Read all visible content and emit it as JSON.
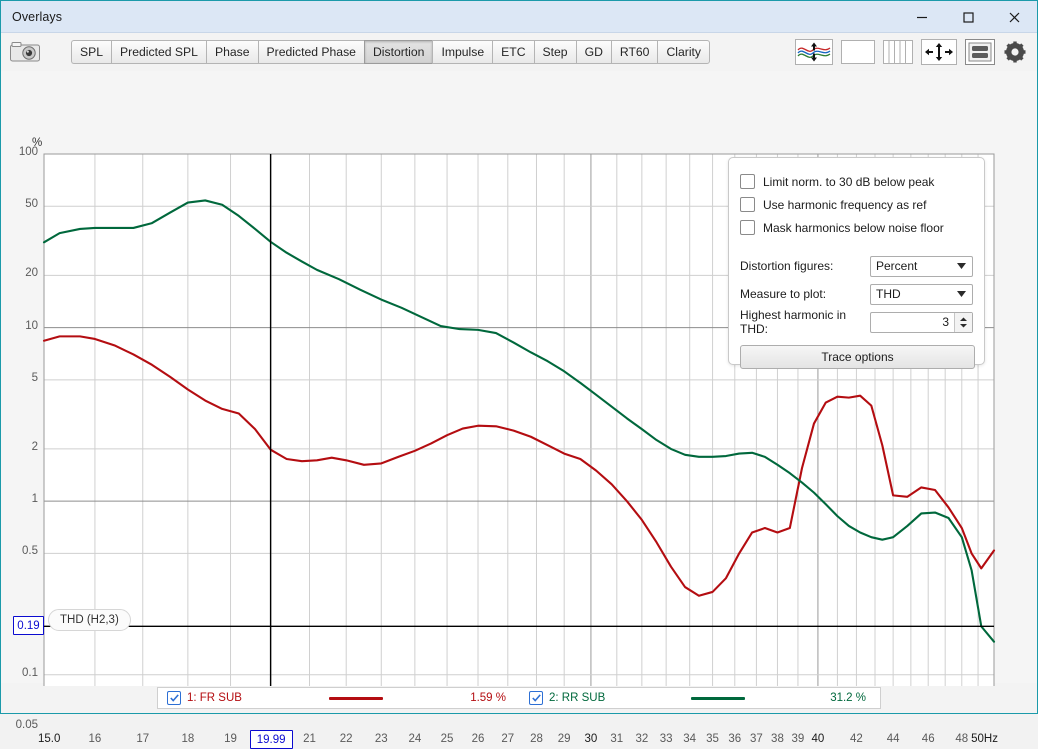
{
  "window": {
    "title": "Overlays",
    "controls": [
      {
        "name": "minimize",
        "glyph": "minimize-icon"
      },
      {
        "name": "maximize",
        "glyph": "maximize-icon"
      },
      {
        "name": "close",
        "glyph": "close-icon"
      }
    ]
  },
  "toolbar": {
    "camera_icon": "camera-icon",
    "tabs": [
      {
        "label": "SPL",
        "active": false
      },
      {
        "label": "Predicted SPL",
        "active": false
      },
      {
        "label": "Phase",
        "active": false
      },
      {
        "label": "Predicted Phase",
        "active": false
      },
      {
        "label": "Distortion",
        "active": true
      },
      {
        "label": "Impulse",
        "active": false
      },
      {
        "label": "ETC",
        "active": false
      },
      {
        "label": "Step",
        "active": false
      },
      {
        "label": "GD",
        "active": false
      },
      {
        "label": "RT60",
        "active": false
      },
      {
        "label": "Clarity",
        "active": false
      }
    ],
    "right_tools": [
      {
        "name": "waveform-offset-icon"
      },
      {
        "name": "blank-panel-icon"
      },
      {
        "name": "vertical-bars-icon"
      },
      {
        "name": "fit-to-window-icon"
      },
      {
        "name": "layout-rows-icon"
      },
      {
        "name": "gear-icon"
      }
    ]
  },
  "settings_panel": {
    "checkboxes": [
      {
        "label": "Limit norm. to 30 dB below peak",
        "checked": false
      },
      {
        "label": "Use harmonic frequency as ref",
        "checked": false
      },
      {
        "label": "Mask harmonics below noise floor",
        "checked": false
      }
    ],
    "fields": [
      {
        "label": "Distortion figures:",
        "value": "Percent",
        "type": "combo"
      },
      {
        "label": "Measure to plot:",
        "value": "THD",
        "type": "combo"
      },
      {
        "label": "Highest harmonic in THD:",
        "value": "3",
        "type": "spinner"
      }
    ],
    "button": "Trace options"
  },
  "chart_data": {
    "type": "line",
    "title": "",
    "badge": "THD (H2,3)",
    "xlabel": "",
    "ylabel": "%",
    "x_unit_suffix": "Hz",
    "xscale": "log",
    "yscale": "log",
    "xlim": [
      15.0,
      50.0
    ],
    "ylim": [
      0.05,
      100
    ],
    "grid": true,
    "legend_position": "bottom",
    "x_ticks": [
      {
        "value": 15.0,
        "label": "15.0",
        "major": true
      },
      {
        "value": 16,
        "label": "16",
        "major": false
      },
      {
        "value": 17,
        "label": "17",
        "major": false
      },
      {
        "value": 18,
        "label": "18",
        "major": false
      },
      {
        "value": 19,
        "label": "19",
        "major": false
      },
      {
        "value": 20,
        "label": "",
        "major": false
      },
      {
        "value": 21,
        "label": "21",
        "major": false
      },
      {
        "value": 22,
        "label": "22",
        "major": false
      },
      {
        "value": 23,
        "label": "23",
        "major": false
      },
      {
        "value": 24,
        "label": "24",
        "major": false
      },
      {
        "value": 25,
        "label": "25",
        "major": false
      },
      {
        "value": 26,
        "label": "26",
        "major": false
      },
      {
        "value": 27,
        "label": "27",
        "major": false
      },
      {
        "value": 28,
        "label": "28",
        "major": false
      },
      {
        "value": 29,
        "label": "29",
        "major": false
      },
      {
        "value": 30,
        "label": "30",
        "major": true
      },
      {
        "value": 31,
        "label": "31",
        "major": false
      },
      {
        "value": 32,
        "label": "32",
        "major": false
      },
      {
        "value": 33,
        "label": "33",
        "major": false
      },
      {
        "value": 34,
        "label": "34",
        "major": false
      },
      {
        "value": 35,
        "label": "35",
        "major": false
      },
      {
        "value": 36,
        "label": "36",
        "major": false
      },
      {
        "value": 37,
        "label": "37",
        "major": false
      },
      {
        "value": 38,
        "label": "38",
        "major": false
      },
      {
        "value": 39,
        "label": "39",
        "major": false
      },
      {
        "value": 40,
        "label": "40",
        "major": true
      },
      {
        "value": 42,
        "label": "42",
        "major": false
      },
      {
        "value": 44,
        "label": "44",
        "major": false
      },
      {
        "value": 46,
        "label": "46",
        "major": false
      },
      {
        "value": 48,
        "label": "48",
        "major": false
      },
      {
        "value": 50,
        "label": "50Hz",
        "major": true
      }
    ],
    "y_ticks": [
      {
        "value": 100,
        "label": "100"
      },
      {
        "value": 50,
        "label": "50"
      },
      {
        "value": 20,
        "label": "20"
      },
      {
        "value": 10,
        "label": "10"
      },
      {
        "value": 5,
        "label": "5"
      },
      {
        "value": 2,
        "label": "2"
      },
      {
        "value": 1,
        "label": "1"
      },
      {
        "value": 0.5,
        "label": "0.5"
      },
      {
        "value": 0.1,
        "label": "0.1"
      },
      {
        "value": 0.05,
        "label": "0.05"
      }
    ],
    "cursor": {
      "x_value": 19.99,
      "x_label": "19.99",
      "y_value": 0.19,
      "y_label": "0.19"
    },
    "series": [
      {
        "name": "1: FR SUB",
        "color": "#b40d11",
        "value_at_cursor": "1.59 %",
        "x": [
          15.0,
          15.3,
          15.7,
          16.0,
          16.4,
          16.8,
          17.2,
          17.6,
          18.0,
          18.4,
          18.8,
          19.2,
          19.6,
          19.99,
          20.4,
          20.8,
          21.2,
          21.6,
          22.0,
          22.5,
          23.0,
          23.5,
          24.0,
          24.5,
          25.0,
          25.5,
          26.0,
          26.6,
          27.2,
          27.8,
          28.4,
          29.0,
          29.6,
          30.2,
          30.8,
          31.4,
          32.0,
          32.6,
          33.2,
          33.8,
          34.4,
          35.0,
          35.6,
          36.2,
          36.8,
          37.4,
          38.0,
          38.6,
          39.2,
          39.8,
          40.4,
          41.0,
          41.6,
          42.2,
          42.8,
          43.4,
          44.0,
          44.8,
          45.6,
          46.4,
          47.2,
          48.0,
          48.6,
          49.2,
          50.0
        ],
        "y": [
          8.4,
          8.9,
          8.9,
          8.6,
          7.9,
          7.0,
          6.1,
          5.2,
          4.4,
          3.8,
          3.4,
          3.2,
          2.6,
          1.98,
          1.75,
          1.7,
          1.72,
          1.78,
          1.72,
          1.62,
          1.65,
          1.8,
          1.95,
          2.15,
          2.4,
          2.62,
          2.72,
          2.7,
          2.55,
          2.35,
          2.1,
          1.88,
          1.75,
          1.5,
          1.25,
          1.0,
          0.78,
          0.58,
          0.42,
          0.32,
          0.285,
          0.3,
          0.36,
          0.5,
          0.66,
          0.7,
          0.66,
          0.7,
          1.55,
          2.8,
          3.7,
          4.0,
          3.95,
          4.05,
          3.55,
          2.1,
          1.08,
          1.06,
          1.2,
          1.16,
          0.92,
          0.7,
          0.5,
          0.41,
          0.52
        ]
      },
      {
        "name": "2: RR SUB",
        "color": "#00683c",
        "value_at_cursor": "31.2 %",
        "x": [
          15.0,
          15.3,
          15.7,
          16.0,
          16.4,
          16.8,
          17.2,
          17.6,
          18.0,
          18.4,
          18.8,
          19.2,
          19.6,
          19.99,
          20.4,
          20.8,
          21.2,
          21.8,
          22.4,
          23.0,
          23.6,
          24.2,
          24.8,
          25.4,
          26.0,
          26.6,
          27.2,
          27.8,
          28.4,
          29.0,
          29.6,
          30.2,
          30.8,
          31.4,
          32.0,
          32.6,
          33.2,
          33.8,
          34.4,
          35.0,
          35.6,
          36.2,
          36.8,
          37.4,
          38.0,
          38.6,
          39.2,
          39.8,
          40.4,
          41.0,
          41.6,
          42.2,
          42.8,
          43.4,
          44.0,
          44.8,
          45.6,
          46.4,
          47.2,
          48.0,
          48.6,
          49.2,
          50.0
        ],
        "y": [
          31.0,
          35.0,
          37.0,
          37.5,
          37.5,
          37.5,
          40.0,
          46.0,
          52.5,
          54.0,
          51.0,
          44.0,
          37.0,
          31.2,
          27.0,
          24.0,
          21.5,
          19.0,
          16.5,
          14.5,
          13.0,
          11.5,
          10.2,
          9.8,
          9.7,
          9.3,
          8.2,
          7.2,
          6.4,
          5.6,
          4.8,
          4.1,
          3.5,
          3.0,
          2.6,
          2.25,
          2.0,
          1.85,
          1.8,
          1.8,
          1.82,
          1.88,
          1.9,
          1.8,
          1.62,
          1.45,
          1.28,
          1.12,
          0.96,
          0.82,
          0.72,
          0.66,
          0.62,
          0.6,
          0.62,
          0.72,
          0.85,
          0.86,
          0.8,
          0.62,
          0.4,
          0.19,
          0.155
        ]
      }
    ]
  },
  "legend": {
    "items": [
      {
        "checked": true,
        "label": "1: FR SUB",
        "color": "#b40d11",
        "value": "1.59 %"
      },
      {
        "checked": true,
        "label": "2: RR SUB",
        "color": "#00683c",
        "value": "31.2 %"
      }
    ]
  }
}
